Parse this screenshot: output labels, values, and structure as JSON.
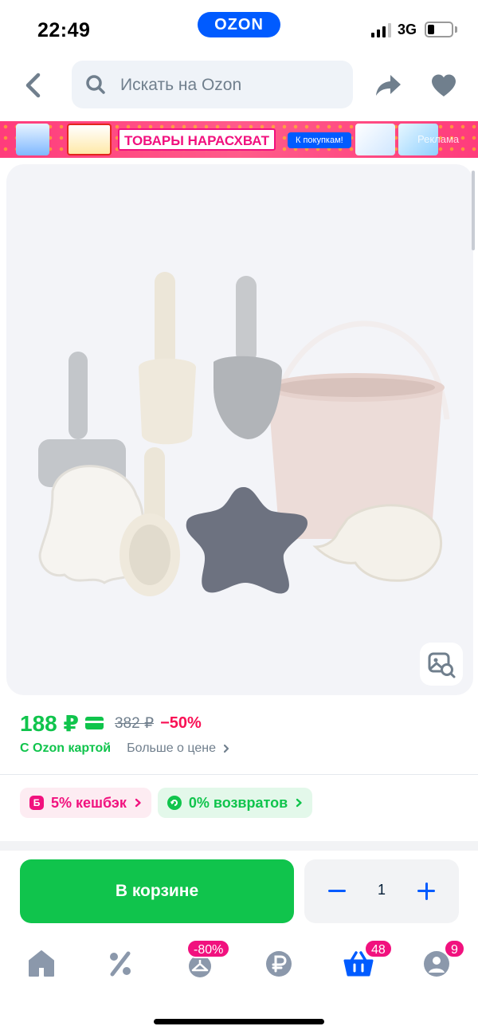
{
  "status_bar": {
    "time": "22:49",
    "brand": "OZON",
    "network": "3G"
  },
  "header": {
    "search_placeholder": "Искать на Ozon",
    "icons": [
      "back-arrow-icon",
      "search-icon",
      "share-icon",
      "heart-icon"
    ]
  },
  "promo_banner": {
    "title": "ТОВАРЫ НАРАСХВАТ",
    "cta": "К покупкам!",
    "ad_label": "Реклама"
  },
  "product": {
    "image_alt": "Набор детских игрушек для песочницы",
    "image_search_icon": "image-search-icon"
  },
  "price": {
    "current": "188 ₽",
    "old": "382 ₽",
    "discount": "−50%",
    "card_label": "С Ozon картой",
    "more_label": "Больше о цене"
  },
  "chips": {
    "cashback_icon": "Б",
    "cashback": "5% кешбэк",
    "returns": "0% возвратов"
  },
  "actions": {
    "cart_label": "В корзине",
    "quantity": "1"
  },
  "tab_bar": {
    "tabs": [
      {
        "name": "home",
        "icon": "home-icon"
      },
      {
        "name": "discounts",
        "icon": "percent-icon"
      },
      {
        "name": "fresh",
        "icon": "hanger-icon",
        "badge": "-80%"
      },
      {
        "name": "finance",
        "icon": "ruble-icon"
      },
      {
        "name": "cart",
        "icon": "basket-icon",
        "badge": "48"
      },
      {
        "name": "profile",
        "icon": "profile-icon",
        "badge": "9"
      }
    ]
  },
  "colors": {
    "brand_blue": "#005bff",
    "green": "#10c44c",
    "pink": "#f1117e",
    "discount_red": "#f91155",
    "tab_icon": "#8b98ab"
  }
}
